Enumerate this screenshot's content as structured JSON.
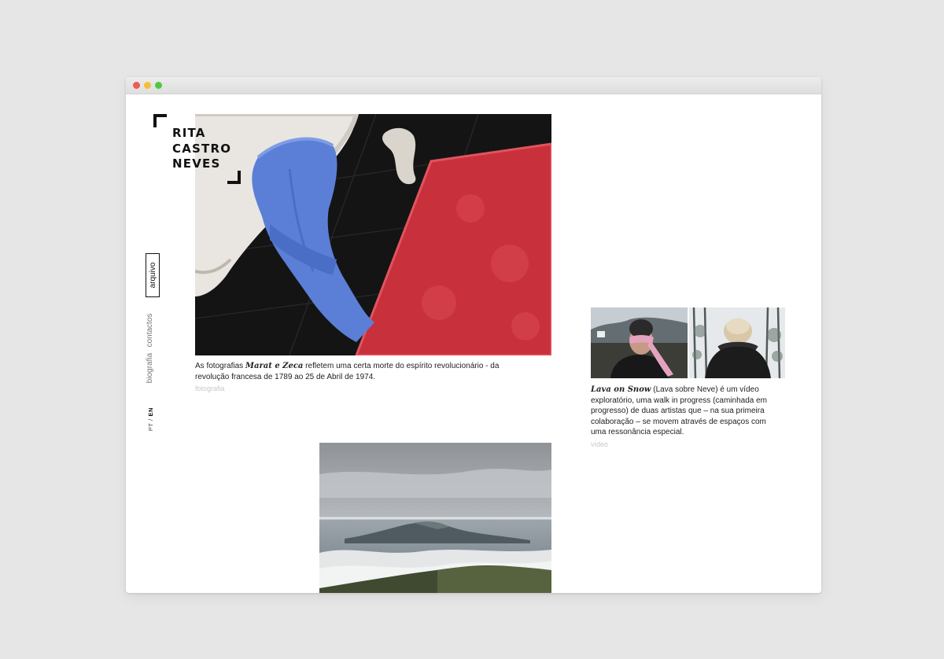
{
  "site": {
    "logo_lines": [
      "RITA",
      "CASTRO",
      "NEVES"
    ]
  },
  "nav": {
    "arquivo": "arquivo",
    "contactos": "contactos",
    "biografia": "biografia",
    "lang_pt": "PT",
    "lang_sep": " / ",
    "lang_en": "EN"
  },
  "works": [
    {
      "caption_pre": "As fotografias ",
      "title": "Marat e Zeca",
      "caption_post": " refletem uma certa morte do espírito revolucionário - da revolução francesa de 1789 ao 25 de Abril de 1974.",
      "category": "fotografia"
    },
    {
      "title": "Lava on Snow",
      "caption_post": " (Lava sobre Neve) é um vídeo exploratório, uma walk in progress (caminhada em progresso) de duas artistas que – na sua primeira colaboração – se movem através de espaços com uma ressonância especial.",
      "category": "vídeo"
    }
  ],
  "colors": {
    "accent": "#111111",
    "muted": "#777777",
    "category": "#c8c8c8",
    "window_red": "#ee5b54",
    "window_yellow": "#f5be3c",
    "window_green": "#4fc840"
  }
}
